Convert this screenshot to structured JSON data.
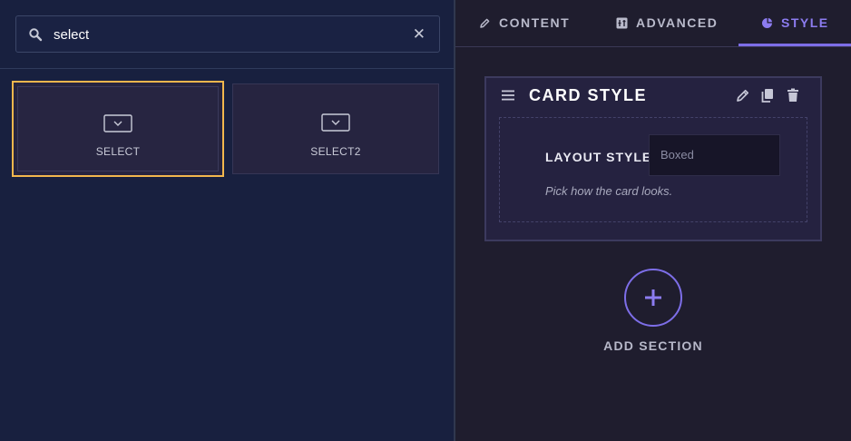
{
  "search": {
    "value": "select",
    "icon": "search-icon",
    "clear_icon": "close-icon",
    "clear_glyph": "✕"
  },
  "widgets": [
    {
      "label": "SELECT",
      "icon": "dropdown-icon",
      "selected": true
    },
    {
      "label": "SELECT2",
      "icon": "dropdown-icon",
      "selected": false
    }
  ],
  "tabs": [
    {
      "label": "CONTENT",
      "icon": "pencil-icon",
      "active": false
    },
    {
      "label": "ADVANCED",
      "icon": "grid-icon",
      "active": false
    },
    {
      "label": "STYLE",
      "icon": "palette-icon",
      "active": true
    }
  ],
  "card": {
    "title": "CARD STYLE",
    "icons": [
      "drag-handle-icon",
      "edit-icon",
      "copy-icon",
      "trash-icon"
    ],
    "field": {
      "label": "LAYOUT STYLE",
      "value": "Boxed",
      "help": "Pick how the card looks."
    }
  },
  "add_section": {
    "label": "ADD SECTION",
    "icon": "plus-icon"
  },
  "colors": {
    "accent": "#7d6ee8",
    "selected_border": "#f2b74d",
    "left_bg": "#18203f",
    "right_bg": "#1f1d2e"
  }
}
